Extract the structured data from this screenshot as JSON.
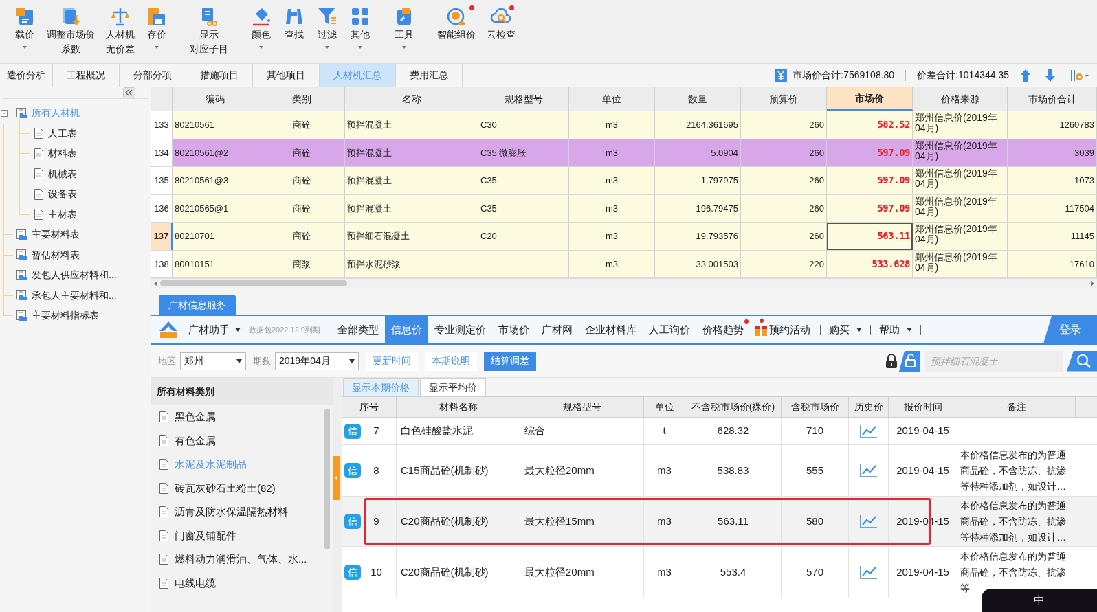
{
  "toolbar": {
    "buttons": [
      {
        "label": "载价",
        "dropdown": true,
        "badge": false
      },
      {
        "lines": [
          "调整市场价",
          "系数"
        ],
        "dropdown": false,
        "badge": false
      },
      {
        "lines": [
          "人材机",
          "无价差"
        ],
        "dropdown": false,
        "badge": false
      },
      {
        "label": "存价",
        "dropdown": true,
        "badge": false
      },
      {
        "lines": [
          "显示",
          "对应子目"
        ],
        "dropdown": false,
        "badge": false
      },
      {
        "label": "颜色",
        "dropdown": true,
        "badge": false
      },
      {
        "label": "查找",
        "dropdown": false,
        "badge": false
      },
      {
        "label": "过滤",
        "dropdown": true,
        "badge": false
      },
      {
        "label": "其他",
        "dropdown": true,
        "badge": false
      },
      {
        "label": "工具",
        "dropdown": true,
        "badge": false
      },
      {
        "label": "智能组价",
        "dropdown": false,
        "badge": true
      },
      {
        "label": "云检查",
        "dropdown": false,
        "badge": true
      }
    ]
  },
  "tabs": [
    {
      "label": "造价分析",
      "selected": false
    },
    {
      "label": "工程概况",
      "selected": false
    },
    {
      "label": "分部分项",
      "selected": false
    },
    {
      "label": "措施项目",
      "selected": false
    },
    {
      "label": "其他项目",
      "selected": false
    },
    {
      "label": "人材机汇总",
      "selected": true
    },
    {
      "label": "费用汇总",
      "selected": false
    }
  ],
  "summary": {
    "market_total": "市场价合计:7569108.80",
    "price_diff_total": "价差合计:1014344.35"
  },
  "tree": [
    {
      "label": "所有人材机",
      "selected": true,
      "expanded": true,
      "children": [
        {
          "label": "人工表",
          "selected": false
        },
        {
          "label": "材料表",
          "selected": false
        },
        {
          "label": "机械表",
          "selected": false
        },
        {
          "label": "设备表",
          "selected": false
        },
        {
          "label": "主材表",
          "selected": false
        }
      ]
    },
    {
      "label": "主要材料表",
      "selected": false
    },
    {
      "label": "暂估材料表",
      "selected": false
    },
    {
      "label": "发包人供应材料和...",
      "selected": false
    },
    {
      "label": "承包人主要材料和...",
      "selected": false
    },
    {
      "label": "主要材料指标表",
      "selected": false
    }
  ],
  "table": {
    "columns": [
      {
        "label": "编码",
        "highlighted": false
      },
      {
        "label": "类别",
        "highlighted": false
      },
      {
        "label": "名称",
        "highlighted": false
      },
      {
        "label": "规格型号",
        "highlighted": false
      },
      {
        "label": "单位",
        "highlighted": false
      },
      {
        "label": "数量",
        "highlighted": false
      },
      {
        "label": "预算价",
        "highlighted": false
      },
      {
        "label": "市场价",
        "highlighted": true
      },
      {
        "label": "价格来源",
        "highlighted": false
      },
      {
        "label": "市场价合计",
        "highlighted": false
      }
    ],
    "rows": [
      {
        "number": "133",
        "selected": false,
        "current": false,
        "cells": [
          "80210561",
          "商砼",
          "预拌混凝土",
          "C30",
          "m3",
          "2164.361695",
          "260",
          "582.52",
          "郑州信息价(2019年04月)",
          "1260783"
        ]
      },
      {
        "number": "134",
        "selected": true,
        "current": false,
        "cells": [
          "80210561@2",
          "商砼",
          "预拌混凝土",
          "C35 微膨胀",
          "m3",
          "5.0904",
          "260",
          "597.09",
          "郑州信息价(2019年04月)",
          "3039"
        ]
      },
      {
        "number": "135",
        "selected": false,
        "current": false,
        "cells": [
          "80210561@3",
          "商砼",
          "预拌混凝土",
          "C35",
          "m3",
          "1.797975",
          "260",
          "597.09",
          "郑州信息价(2019年04月)",
          "1073"
        ]
      },
      {
        "number": "136",
        "selected": false,
        "current": false,
        "cells": [
          "80210565@1",
          "商砼",
          "预拌混凝土",
          "C35",
          "m3",
          "196.79475",
          "260",
          "597.09",
          "郑州信息价(2019年04月)",
          "117504"
        ]
      },
      {
        "number": "137",
        "selected": false,
        "current": true,
        "cells": [
          "80210701",
          "商砼",
          "预拌细石混凝土",
          "C20",
          "m3",
          "19.793576",
          "260",
          "563.11",
          "郑州信息价(2019年04月)",
          "11145"
        ]
      },
      {
        "number": "138",
        "selected": false,
        "current": false,
        "cells": [
          "80010151",
          "商浆",
          "预拌水泥砂浆",
          "",
          "m3",
          "33.001503",
          "220",
          "533.628",
          "郑州信息价(2019年04月)",
          "17610"
        ]
      }
    ]
  },
  "service": {
    "tab": "广材信息服务",
    "assistant": "广材助手",
    "data_note": "数据包2022.12.9到期",
    "nav": [
      {
        "label": "全部类型",
        "selected": false,
        "badge": false,
        "kind": "tab"
      },
      {
        "label": "信息价",
        "selected": true,
        "badge": false,
        "kind": "tab"
      },
      {
        "label": "专业测定价",
        "selected": false,
        "badge": false,
        "kind": "tab"
      },
      {
        "label": "市场价",
        "selected": false,
        "badge": false,
        "kind": "tab"
      },
      {
        "label": "广材网",
        "selected": false,
        "badge": false,
        "kind": "tab"
      },
      {
        "label": "企业材料库",
        "selected": false,
        "badge": false,
        "kind": "tab"
      },
      {
        "label": "人工询价",
        "selected": false,
        "badge": false,
        "kind": "tab"
      },
      {
        "label": "价格趋势",
        "selected": false,
        "badge": true,
        "kind": "tab"
      },
      {
        "label": "预约活动",
        "badge": true,
        "kind": "gift"
      },
      {
        "label": "购买",
        "kind": "menu"
      },
      {
        "label": "帮助",
        "kind": "menu"
      }
    ],
    "login": "登录",
    "filters": {
      "region_label": "地区",
      "region": "郑州",
      "period_label": "期数",
      "period": "2019年04月",
      "buttons": [
        {
          "label": "更新时间",
          "primary": false
        },
        {
          "label": "本期说明",
          "primary": false
        },
        {
          "label": "结算调差",
          "primary": true
        }
      ],
      "search_placeholder": "预拌细石混凝土"
    },
    "categories": {
      "title": "所有材料类别",
      "items": [
        {
          "label": "黑色金属",
          "selected": false
        },
        {
          "label": "有色金属",
          "selected": false
        },
        {
          "label": "水泥及水泥制品",
          "selected": true
        },
        {
          "label": "砖瓦灰砂石土粉土(82)",
          "selected": false
        },
        {
          "label": "沥青及防水保温隔热材料",
          "selected": false
        },
        {
          "label": "门窗及铺配件",
          "selected": false
        },
        {
          "label": "燃料动力润滑油、气体、水...",
          "selected": false
        },
        {
          "label": "电线电缆",
          "selected": false
        }
      ]
    },
    "view_tabs": [
      {
        "label": "显示本期价格",
        "selected": true
      },
      {
        "label": "显示平均价",
        "selected": false
      }
    ],
    "columns": [
      "序号",
      "材料名称",
      "规格型号",
      "单位",
      "不含税市场价(裸价)",
      "含税市场价",
      "历史价",
      "报价时间",
      "备注"
    ],
    "rows": [
      {
        "tag": "信",
        "seq": "7",
        "name": "白色硅酸盐水泥",
        "spec": "综合",
        "unit": "t",
        "price_ex": "628.32",
        "price_in": "710",
        "date": "2019-04-15",
        "marked": false
      },
      {
        "tag": "信",
        "seq": "8",
        "name": "C15商品砼(机制砂)",
        "spec": "最大粒径20mm",
        "unit": "m3",
        "price_ex": "538.83",
        "price_in": "555",
        "date": "2019-04-15",
        "note": "本价格信息发布的为普通商品砼，不含防冻、抗渗等特种添加剂，如设计…",
        "marked": false
      },
      {
        "tag": "信",
        "seq": "9",
        "name": "C20商品砼(机制砂)",
        "spec": "最大粒径15mm",
        "unit": "m3",
        "price_ex": "563.11",
        "price_in": "580",
        "date": "2019-04-15",
        "note": "本价格信息发布的为普通商品砼，不含防冻、抗渗等特种添加剂，如设计…",
        "marked": true
      },
      {
        "tag": "信",
        "seq": "10",
        "name": "C20商品砼(机制砂)",
        "spec": "最大粒径20mm",
        "unit": "m3",
        "price_ex": "553.4",
        "price_in": "570",
        "date": "2019-04-15",
        "note": "本价格信息发布的为普通商品砼，不含防冻、抗渗等",
        "marked": false
      }
    ]
  },
  "ime": "中"
}
